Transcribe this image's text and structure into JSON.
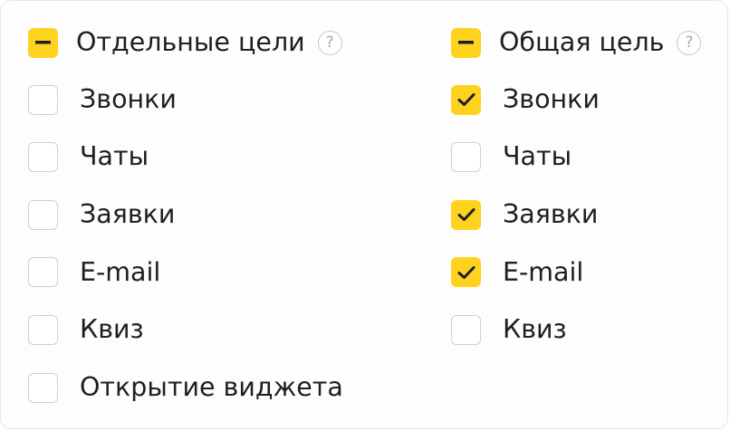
{
  "left_group": {
    "header": {
      "label": "Отдельные цели",
      "state": "indeterminate",
      "help_icon": "?"
    },
    "items": [
      {
        "label": "Звонки",
        "checked": false
      },
      {
        "label": "Чаты",
        "checked": false
      },
      {
        "label": "Заявки",
        "checked": false
      },
      {
        "label": "E-mail",
        "checked": false
      },
      {
        "label": "Квиз",
        "checked": false
      },
      {
        "label": "Открытие виджета",
        "checked": false
      }
    ]
  },
  "right_group": {
    "header": {
      "label": "Общая цель",
      "state": "indeterminate",
      "help_icon": "?"
    },
    "items": [
      {
        "label": "Звонки",
        "checked": true
      },
      {
        "label": "Чаты",
        "checked": false
      },
      {
        "label": "Заявки",
        "checked": true
      },
      {
        "label": "E-mail",
        "checked": true
      },
      {
        "label": "Квиз",
        "checked": false
      }
    ]
  },
  "colors": {
    "accent": "#ffd21f",
    "checkbox_border": "#cfcfcf",
    "text": "#1f1f1f",
    "help_icon": "#a8a8a8"
  }
}
